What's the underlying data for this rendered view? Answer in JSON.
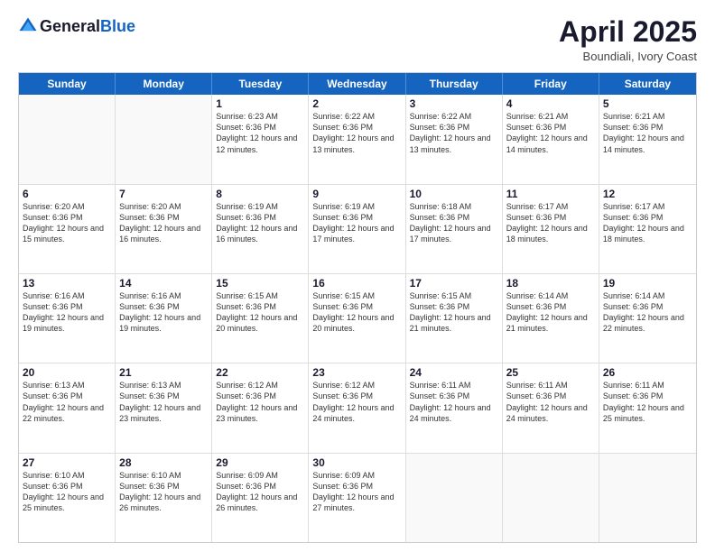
{
  "header": {
    "logo_general": "General",
    "logo_blue": "Blue",
    "month": "April 2025",
    "location": "Boundiali, Ivory Coast"
  },
  "days_of_week": [
    "Sunday",
    "Monday",
    "Tuesday",
    "Wednesday",
    "Thursday",
    "Friday",
    "Saturday"
  ],
  "weeks": [
    [
      {
        "day": "",
        "sunrise": "",
        "sunset": "",
        "daylight": ""
      },
      {
        "day": "",
        "sunrise": "",
        "sunset": "",
        "daylight": ""
      },
      {
        "day": "1",
        "sunrise": "Sunrise: 6:23 AM",
        "sunset": "Sunset: 6:36 PM",
        "daylight": "Daylight: 12 hours and 12 minutes."
      },
      {
        "day": "2",
        "sunrise": "Sunrise: 6:22 AM",
        "sunset": "Sunset: 6:36 PM",
        "daylight": "Daylight: 12 hours and 13 minutes."
      },
      {
        "day": "3",
        "sunrise": "Sunrise: 6:22 AM",
        "sunset": "Sunset: 6:36 PM",
        "daylight": "Daylight: 12 hours and 13 minutes."
      },
      {
        "day": "4",
        "sunrise": "Sunrise: 6:21 AM",
        "sunset": "Sunset: 6:36 PM",
        "daylight": "Daylight: 12 hours and 14 minutes."
      },
      {
        "day": "5",
        "sunrise": "Sunrise: 6:21 AM",
        "sunset": "Sunset: 6:36 PM",
        "daylight": "Daylight: 12 hours and 14 minutes."
      }
    ],
    [
      {
        "day": "6",
        "sunrise": "Sunrise: 6:20 AM",
        "sunset": "Sunset: 6:36 PM",
        "daylight": "Daylight: 12 hours and 15 minutes."
      },
      {
        "day": "7",
        "sunrise": "Sunrise: 6:20 AM",
        "sunset": "Sunset: 6:36 PM",
        "daylight": "Daylight: 12 hours and 16 minutes."
      },
      {
        "day": "8",
        "sunrise": "Sunrise: 6:19 AM",
        "sunset": "Sunset: 6:36 PM",
        "daylight": "Daylight: 12 hours and 16 minutes."
      },
      {
        "day": "9",
        "sunrise": "Sunrise: 6:19 AM",
        "sunset": "Sunset: 6:36 PM",
        "daylight": "Daylight: 12 hours and 17 minutes."
      },
      {
        "day": "10",
        "sunrise": "Sunrise: 6:18 AM",
        "sunset": "Sunset: 6:36 PM",
        "daylight": "Daylight: 12 hours and 17 minutes."
      },
      {
        "day": "11",
        "sunrise": "Sunrise: 6:17 AM",
        "sunset": "Sunset: 6:36 PM",
        "daylight": "Daylight: 12 hours and 18 minutes."
      },
      {
        "day": "12",
        "sunrise": "Sunrise: 6:17 AM",
        "sunset": "Sunset: 6:36 PM",
        "daylight": "Daylight: 12 hours and 18 minutes."
      }
    ],
    [
      {
        "day": "13",
        "sunrise": "Sunrise: 6:16 AM",
        "sunset": "Sunset: 6:36 PM",
        "daylight": "Daylight: 12 hours and 19 minutes."
      },
      {
        "day": "14",
        "sunrise": "Sunrise: 6:16 AM",
        "sunset": "Sunset: 6:36 PM",
        "daylight": "Daylight: 12 hours and 19 minutes."
      },
      {
        "day": "15",
        "sunrise": "Sunrise: 6:15 AM",
        "sunset": "Sunset: 6:36 PM",
        "daylight": "Daylight: 12 hours and 20 minutes."
      },
      {
        "day": "16",
        "sunrise": "Sunrise: 6:15 AM",
        "sunset": "Sunset: 6:36 PM",
        "daylight": "Daylight: 12 hours and 20 minutes."
      },
      {
        "day": "17",
        "sunrise": "Sunrise: 6:15 AM",
        "sunset": "Sunset: 6:36 PM",
        "daylight": "Daylight: 12 hours and 21 minutes."
      },
      {
        "day": "18",
        "sunrise": "Sunrise: 6:14 AM",
        "sunset": "Sunset: 6:36 PM",
        "daylight": "Daylight: 12 hours and 21 minutes."
      },
      {
        "day": "19",
        "sunrise": "Sunrise: 6:14 AM",
        "sunset": "Sunset: 6:36 PM",
        "daylight": "Daylight: 12 hours and 22 minutes."
      }
    ],
    [
      {
        "day": "20",
        "sunrise": "Sunrise: 6:13 AM",
        "sunset": "Sunset: 6:36 PM",
        "daylight": "Daylight: 12 hours and 22 minutes."
      },
      {
        "day": "21",
        "sunrise": "Sunrise: 6:13 AM",
        "sunset": "Sunset: 6:36 PM",
        "daylight": "Daylight: 12 hours and 23 minutes."
      },
      {
        "day": "22",
        "sunrise": "Sunrise: 6:12 AM",
        "sunset": "Sunset: 6:36 PM",
        "daylight": "Daylight: 12 hours and 23 minutes."
      },
      {
        "day": "23",
        "sunrise": "Sunrise: 6:12 AM",
        "sunset": "Sunset: 6:36 PM",
        "daylight": "Daylight: 12 hours and 24 minutes."
      },
      {
        "day": "24",
        "sunrise": "Sunrise: 6:11 AM",
        "sunset": "Sunset: 6:36 PM",
        "daylight": "Daylight: 12 hours and 24 minutes."
      },
      {
        "day": "25",
        "sunrise": "Sunrise: 6:11 AM",
        "sunset": "Sunset: 6:36 PM",
        "daylight": "Daylight: 12 hours and 24 minutes."
      },
      {
        "day": "26",
        "sunrise": "Sunrise: 6:11 AM",
        "sunset": "Sunset: 6:36 PM",
        "daylight": "Daylight: 12 hours and 25 minutes."
      }
    ],
    [
      {
        "day": "27",
        "sunrise": "Sunrise: 6:10 AM",
        "sunset": "Sunset: 6:36 PM",
        "daylight": "Daylight: 12 hours and 25 minutes."
      },
      {
        "day": "28",
        "sunrise": "Sunrise: 6:10 AM",
        "sunset": "Sunset: 6:36 PM",
        "daylight": "Daylight: 12 hours and 26 minutes."
      },
      {
        "day": "29",
        "sunrise": "Sunrise: 6:09 AM",
        "sunset": "Sunset: 6:36 PM",
        "daylight": "Daylight: 12 hours and 26 minutes."
      },
      {
        "day": "30",
        "sunrise": "Sunrise: 6:09 AM",
        "sunset": "Sunset: 6:36 PM",
        "daylight": "Daylight: 12 hours and 27 minutes."
      },
      {
        "day": "",
        "sunrise": "",
        "sunset": "",
        "daylight": ""
      },
      {
        "day": "",
        "sunrise": "",
        "sunset": "",
        "daylight": ""
      },
      {
        "day": "",
        "sunrise": "",
        "sunset": "",
        "daylight": ""
      }
    ]
  ]
}
